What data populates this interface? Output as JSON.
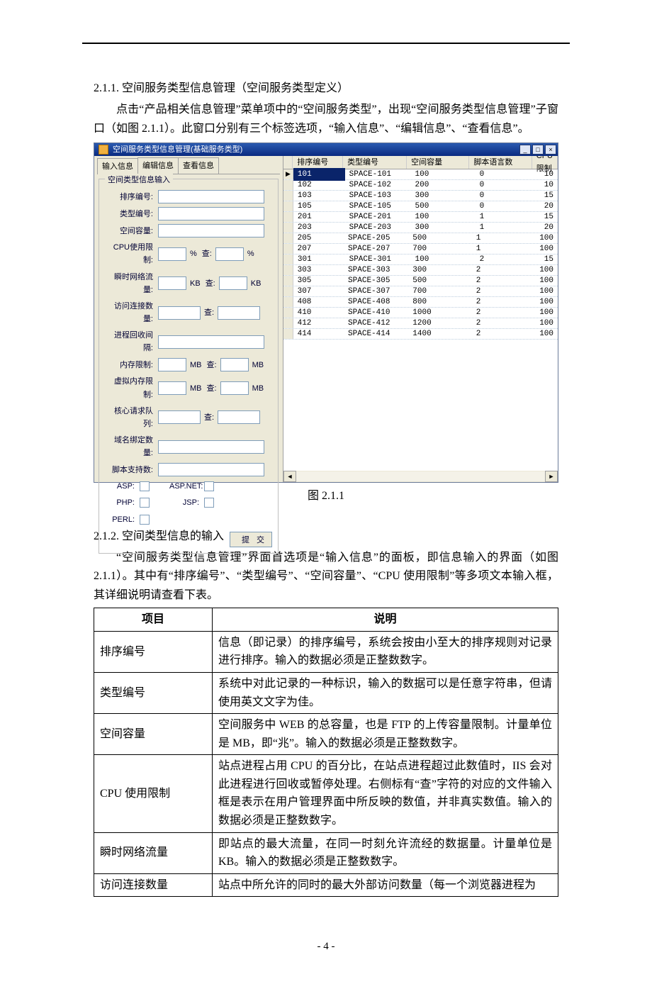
{
  "section1": {
    "num": "2.1.1.",
    "title": "空间服务类型信息管理（空间服务类型定义）",
    "para": "点击“产品相关信息管理”菜单项中的“空间服务类型”，出现“空间服务类型信息管理”子窗口（如图 2.1.1）。此窗口分别有三个标签选项，“输入信息”、“编辑信息”、“查看信息”。"
  },
  "figcap": {
    "label": "图",
    "num": "2.1.1"
  },
  "win": {
    "title": "空间服务类型信息管理(基础服务类型)",
    "btn_min": "_",
    "btn_max": "□",
    "btn_close": "×",
    "tabs": [
      "输入信息",
      "编辑信息",
      "查看信息"
    ],
    "group_title": "空间类型信息输入",
    "labels": {
      "sort_no": "排序编号:",
      "type_no": "类型编号:",
      "space_cap": "空间容量:",
      "cpu_limit": "CPU使用限制:",
      "cha": "查:",
      "pct": "%",
      "kb": "KB",
      "mb": "MB",
      "net_flow": "瞬时网络流量:",
      "conn_cnt": "访问连接数量:",
      "proc_int": "进程回收间隔:",
      "mem_limit": "内存限制:",
      "vmem_limit": "虚拟内存限制:",
      "kreq_q": "核心请求队列:",
      "dom_bind": "域名绑定数量:",
      "script_cnt": "脚本支持数:",
      "asp": "ASP:",
      "aspnet": "ASP.NET:",
      "php": "PHP:",
      "jsp": "JSP:",
      "perl": "PERL:",
      "submit": "提交"
    },
    "cols": [
      "排序编号",
      "类型编号",
      "空间容量",
      "脚本语言数",
      "CPU限制"
    ],
    "rows": [
      {
        "a": "101",
        "b": "SPACE-101",
        "c": "100",
        "d": "0",
        "e": "10"
      },
      {
        "a": "102",
        "b": "SPACE-102",
        "c": "200",
        "d": "0",
        "e": "10"
      },
      {
        "a": "103",
        "b": "SPACE-103",
        "c": "300",
        "d": "0",
        "e": "15"
      },
      {
        "a": "105",
        "b": "SPACE-105",
        "c": "500",
        "d": "0",
        "e": "20"
      },
      {
        "a": "201",
        "b": "SPACE-201",
        "c": "100",
        "d": "1",
        "e": "15"
      },
      {
        "a": "203",
        "b": "SPACE-203",
        "c": "300",
        "d": "1",
        "e": "20"
      },
      {
        "a": "205",
        "b": "SPACE-205",
        "c": "500",
        "d": "1",
        "e": "100"
      },
      {
        "a": "207",
        "b": "SPACE-207",
        "c": "700",
        "d": "1",
        "e": "100"
      },
      {
        "a": "301",
        "b": "SPACE-301",
        "c": "100",
        "d": "2",
        "e": "15"
      },
      {
        "a": "303",
        "b": "SPACE-303",
        "c": "300",
        "d": "2",
        "e": "100"
      },
      {
        "a": "305",
        "b": "SPACE-305",
        "c": "500",
        "d": "2",
        "e": "100"
      },
      {
        "a": "307",
        "b": "SPACE-307",
        "c": "700",
        "d": "2",
        "e": "100"
      },
      {
        "a": "408",
        "b": "SPACE-408",
        "c": "800",
        "d": "2",
        "e": "100"
      },
      {
        "a": "410",
        "b": "SPACE-410",
        "c": "1000",
        "d": "2",
        "e": "100"
      },
      {
        "a": "412",
        "b": "SPACE-412",
        "c": "1200",
        "d": "2",
        "e": "100"
      },
      {
        "a": "414",
        "b": "SPACE-414",
        "c": "1400",
        "d": "2",
        "e": "100"
      }
    ]
  },
  "section2": {
    "num": "2.1.2.",
    "title": "空间类型信息的输入",
    "para": "“空间服务类型信息管理”界面首选项是“输入信息”的面板，即信息输入的界面（如图 2.1.1）。其中有“排序编号”、“类型编号”、“空间容量”、“CPU 使用限制”等多项文本输入框，其详细说明请查看下表。"
  },
  "table": {
    "h1": "项目",
    "h2": "说明",
    "rows": [
      {
        "k": "排序编号",
        "v": "信息（即记录）的排序编号，系统会按由小至大的排序规则对记录进行排序。输入的数据必须是正整数数字。"
      },
      {
        "k": "类型编号",
        "v": "系统中对此记录的一种标识，输入的数据可以是任意字符串，但请使用英文文字为佳。"
      },
      {
        "k": "空间容量",
        "v": "空间服务中 WEB 的总容量，也是 FTP 的上传容量限制。计量单位是 MB，即“兆”。输入的数据必须是正整数数字。"
      },
      {
        "k": "CPU 使用限制",
        "v": "站点进程占用 CPU 的百分比，在站点进程超过此数值时，IIS 会对此进程进行回收或暂停处理。右侧标有“查”字符的对应的文件输入框是表示在用户管理界面中所反映的数值，并非真实数值。输入的数据必须是正整数数字。"
      },
      {
        "k": "瞬时网络流量",
        "v": "即站点的最大流量，在同一时刻允许流经的数据量。计量单位是 KB。输入的数据必须是正整数数字。"
      },
      {
        "k": "访问连接数量",
        "v": "站点中所允许的同时的最大外部访问数量（每一个浏览器进程为"
      }
    ]
  },
  "footer": "- 4 -"
}
